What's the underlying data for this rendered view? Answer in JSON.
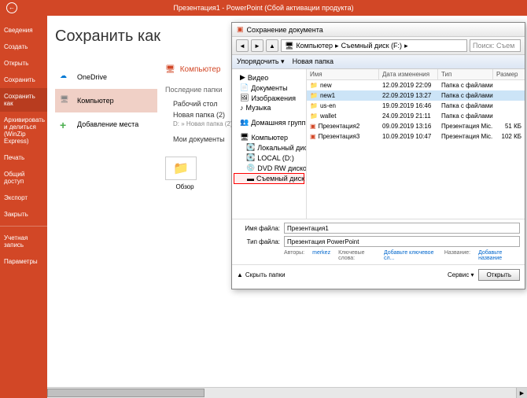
{
  "titlebar": {
    "text": "Презентация1 - PowerPoint (Сбой активации продукта)"
  },
  "sidebar": {
    "items": [
      "Сведения",
      "Создать",
      "Открыть",
      "Сохранить",
      "Сохранить как",
      "Архивировать и делиться (WinZip Express)",
      "Печать",
      "Общий доступ",
      "Экспорт",
      "Закрыть"
    ],
    "items2": [
      "Учетная запись",
      "Параметры"
    ]
  },
  "page": {
    "title": "Сохранить как"
  },
  "locations": {
    "items": [
      {
        "label": "OneDrive",
        "icon": "cloud"
      },
      {
        "label": "Компьютер",
        "icon": "pc"
      },
      {
        "label": "Добавление места",
        "icon": "plus"
      }
    ]
  },
  "detail": {
    "title": "Компьютер",
    "recent_label": "Последние папки",
    "folders": [
      {
        "name": "Рабочий стол",
        "sub": ""
      },
      {
        "name": "Новая папка (2)",
        "sub": "D: » Новая папка (2)"
      },
      {
        "name": "Мои документы",
        "sub": ""
      }
    ],
    "browse": "Обзор"
  },
  "dialog": {
    "title": "Сохранение документа",
    "breadcrumb": [
      "Компьютер",
      "Съемный диск (F:)"
    ],
    "search_placeholder": "Поиск: Съем",
    "toolbar": {
      "organize": "Упорядочить ▾",
      "new_folder": "Новая папка"
    },
    "tree": [
      {
        "label": "Видео",
        "indent": false
      },
      {
        "label": "Документы",
        "indent": false
      },
      {
        "label": "Изображения",
        "indent": false
      },
      {
        "label": "Музыка",
        "indent": false
      },
      {
        "label": "Домашняя групп",
        "indent": false,
        "gap": true
      },
      {
        "label": "Компьютер",
        "indent": false,
        "gap": true
      },
      {
        "label": "Локальный диск",
        "indent": true
      },
      {
        "label": "LOCAL (D:)",
        "indent": true
      },
      {
        "label": "DVD RW дисково",
        "indent": true
      },
      {
        "label": "Съемный диск (",
        "indent": true,
        "hl": true
      }
    ],
    "headers": {
      "name": "Имя",
      "date": "Дата изменения",
      "type": "Тип",
      "size": "Размер"
    },
    "files": [
      {
        "name": "new",
        "date": "12.09.2019 22:09",
        "type": "Папка с файлами",
        "size": "",
        "icon": "folder"
      },
      {
        "name": "new1",
        "date": "22.09.2019 13:27",
        "type": "Папка с файлами",
        "size": "",
        "icon": "folder",
        "sel": true
      },
      {
        "name": "us-en",
        "date": "19.09.2019 16:46",
        "type": "Папка с файлами",
        "size": "",
        "icon": "folder"
      },
      {
        "name": "wallet",
        "date": "24.09.2019 21:11",
        "type": "Папка с файлами",
        "size": "",
        "icon": "folder"
      },
      {
        "name": "Презентация2",
        "date": "09.09.2019 13:16",
        "type": "Презентация Mic...",
        "size": "51 КБ",
        "icon": "ppt"
      },
      {
        "name": "Презентация3",
        "date": "10.09.2019 10:47",
        "type": "Презентация Mic...",
        "size": "102 КБ",
        "icon": "ppt"
      }
    ],
    "filename_label": "Имя файла:",
    "filename": "Презентация1",
    "filetype_label": "Тип файла:",
    "filetype": "Презентация PowerPoint",
    "meta": {
      "authors_label": "Авторы:",
      "authors": "merkez",
      "keywords_label": "Ключевые слова:",
      "keywords": "Добавьте ключевое сл...",
      "title_label": "Название:",
      "title": "Добавьте название"
    },
    "hide_folders": "Скрыть папки",
    "service": "Сервис ▾",
    "open": "Открыть"
  }
}
